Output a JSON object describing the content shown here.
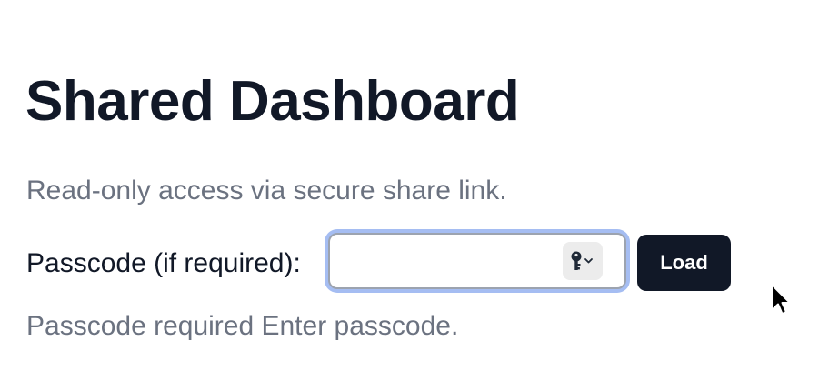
{
  "header": {
    "title": "Shared Dashboard",
    "subtitle": "Read-only access via secure share link."
  },
  "passcode": {
    "label": "Passcode (if required):",
    "value": "",
    "placeholder": "",
    "autofill_icon": "key-icon",
    "load_label": "Load"
  },
  "status": {
    "message": "Passcode required Enter passcode."
  },
  "colors": {
    "title": "#111827",
    "muted_text": "#6b7280",
    "button_bg": "#111827",
    "focus_ring": "#a5bdf2"
  }
}
